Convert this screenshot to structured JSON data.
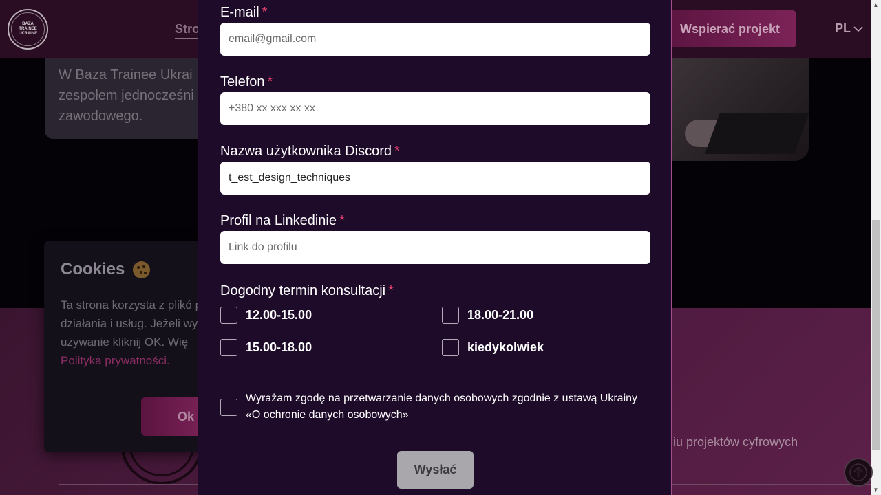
{
  "header": {
    "logo_text": "BAZA\nTRAINEE\nUKRAINE",
    "nav_main": "Stro",
    "support_label": "Wspierać projekt",
    "language": "PL"
  },
  "background": {
    "info_text": "W Baza Trainee Ukrai\nzespołem jednocześni\nzawodowego.",
    "footer_text": "niu projektów cyfrowych"
  },
  "cookie": {
    "title": "Cookies",
    "text": "Ta strona korzysta z plikó prawidłowego działania i usług. Jeżeli wyrażasz zg używanie kliknij OK. Wię",
    "link": "Polityka prywatności.",
    "ok_label": "Ok"
  },
  "form": {
    "email": {
      "label": "E-mail",
      "required": "*",
      "placeholder": "email@gmail.com",
      "value": ""
    },
    "phone": {
      "label": "Telefon",
      "required": "*",
      "placeholder": "+380 xx xxx xx xx",
      "value": ""
    },
    "discord": {
      "label": "Nazwa użytkownika Discord",
      "required": "*",
      "placeholder": "",
      "value": "t_est_design_techniques"
    },
    "linkedin": {
      "label": "Profil na Linkedinie",
      "required": "*",
      "placeholder": "Link do profilu",
      "value": ""
    },
    "consultation": {
      "label": "Dogodny termin konsultacji",
      "required": "*",
      "options": [
        "12.00-15.00",
        "18.00-21.00",
        "15.00-18.00",
        "kiedykolwiek"
      ]
    },
    "consent": "Wyrażam zgodę na przetwarzanie danych osobowych zgodnie z ustawą Ukrainy «O ochronie danych osobowych»",
    "submit_label": "Wysłać"
  }
}
